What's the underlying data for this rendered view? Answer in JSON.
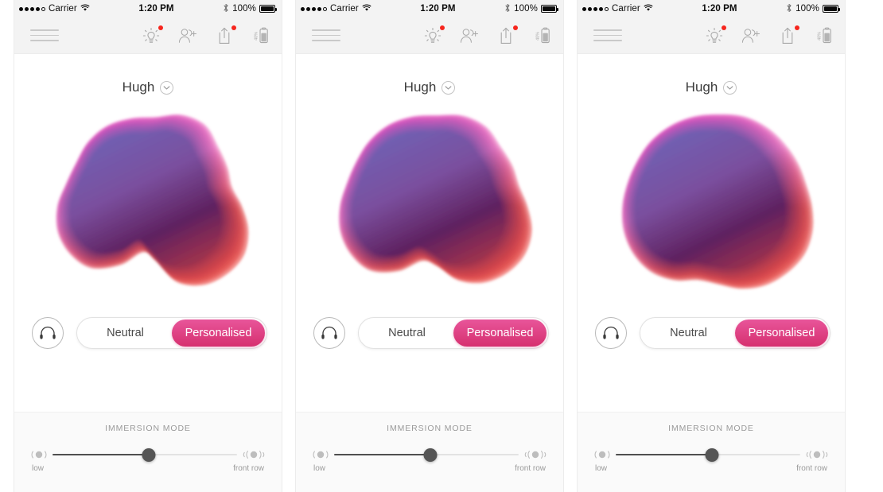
{
  "accent": {
    "pink_light": "#e8559a",
    "pink_dark": "#d6306f",
    "red_dot": "#f6251d",
    "blob_blue": "#6e62b5",
    "blob_purple": "#7a4f9e",
    "blob_deep": "#5e2160",
    "blob_magenta": "#f049c0",
    "blob_pink": "#ff78c4",
    "blob_red": "#f0504a",
    "header_bg": "#f3f3f3",
    "immersion_bg": "#fafafa"
  },
  "panels": [
    {
      "status_bar": {
        "signal_dots_filled": 4,
        "signal_dots_total": 5,
        "carrier": "Carrier",
        "wifi_icon": "wifi-icon",
        "time": "1:20 PM",
        "bluetooth_icon": "bluetooth-icon",
        "battery_percent": "100%",
        "battery_icon": "battery-full-icon"
      },
      "navbar": {
        "menu_icon": "hamburger-menu-icon",
        "icons": [
          {
            "name": "brightness-sun-icon",
            "badge": true
          },
          {
            "name": "add-person-icon",
            "badge": false
          },
          {
            "name": "share-upload-icon",
            "badge": true
          },
          {
            "name": "device-battery-40-icon",
            "badge": false,
            "label": "40%"
          }
        ]
      },
      "profile": {
        "name": "Hugh",
        "chevron_icon": "chevron-down-circle-icon"
      },
      "visual": {
        "name": "hearing-profile-blob",
        "variant": 1
      },
      "headphones_icon": "headphones-icon",
      "segmented": {
        "options": [
          "Neutral",
          "Personalised"
        ],
        "selected_index": 1
      },
      "immersion": {
        "title": "IMMERSION MODE",
        "min_icon": "sound-low-icon",
        "max_icon": "sound-high-icon",
        "min_label": "low",
        "max_label": "front row",
        "value_percent": 52
      }
    },
    {
      "status_bar": {
        "signal_dots_filled": 4,
        "signal_dots_total": 5,
        "carrier": "Carrier",
        "wifi_icon": "wifi-icon",
        "time": "1:20 PM",
        "bluetooth_icon": "bluetooth-icon",
        "battery_percent": "100%",
        "battery_icon": "battery-full-icon"
      },
      "navbar": {
        "menu_icon": "hamburger-menu-icon",
        "icons": [
          {
            "name": "brightness-sun-icon",
            "badge": true
          },
          {
            "name": "add-person-icon",
            "badge": false
          },
          {
            "name": "share-upload-icon",
            "badge": true
          },
          {
            "name": "device-battery-40-icon",
            "badge": false,
            "label": "40%"
          }
        ]
      },
      "profile": {
        "name": "Hugh",
        "chevron_icon": "chevron-down-circle-icon"
      },
      "visual": {
        "name": "hearing-profile-blob",
        "variant": 2
      },
      "headphones_icon": "headphones-icon",
      "segmented": {
        "options": [
          "Neutral",
          "Personalised"
        ],
        "selected_index": 1
      },
      "immersion": {
        "title": "IMMERSION MODE",
        "min_icon": "sound-low-icon",
        "max_icon": "sound-high-icon",
        "min_label": "low",
        "max_label": "front row",
        "value_percent": 52
      }
    },
    {
      "status_bar": {
        "signal_dots_filled": 4,
        "signal_dots_total": 5,
        "carrier": "Carrier",
        "wifi_icon": "wifi-icon",
        "time": "1:20 PM",
        "bluetooth_icon": "bluetooth-icon",
        "battery_percent": "100%",
        "battery_icon": "battery-full-icon"
      },
      "navbar": {
        "menu_icon": "hamburger-menu-icon",
        "icons": [
          {
            "name": "brightness-sun-icon",
            "badge": true
          },
          {
            "name": "add-person-icon",
            "badge": false
          },
          {
            "name": "share-upload-icon",
            "badge": true
          },
          {
            "name": "device-battery-40-icon",
            "badge": false,
            "label": "40%"
          }
        ]
      },
      "profile": {
        "name": "Hugh",
        "chevron_icon": "chevron-down-circle-icon"
      },
      "visual": {
        "name": "hearing-profile-blob",
        "variant": 3
      },
      "headphones_icon": "headphones-icon",
      "segmented": {
        "options": [
          "Neutral",
          "Personalised"
        ],
        "selected_index": 1
      },
      "immersion": {
        "title": "IMMERSION MODE",
        "min_icon": "sound-low-icon",
        "max_icon": "sound-high-icon",
        "min_label": "low",
        "max_label": "front row",
        "value_percent": 52
      }
    }
  ]
}
